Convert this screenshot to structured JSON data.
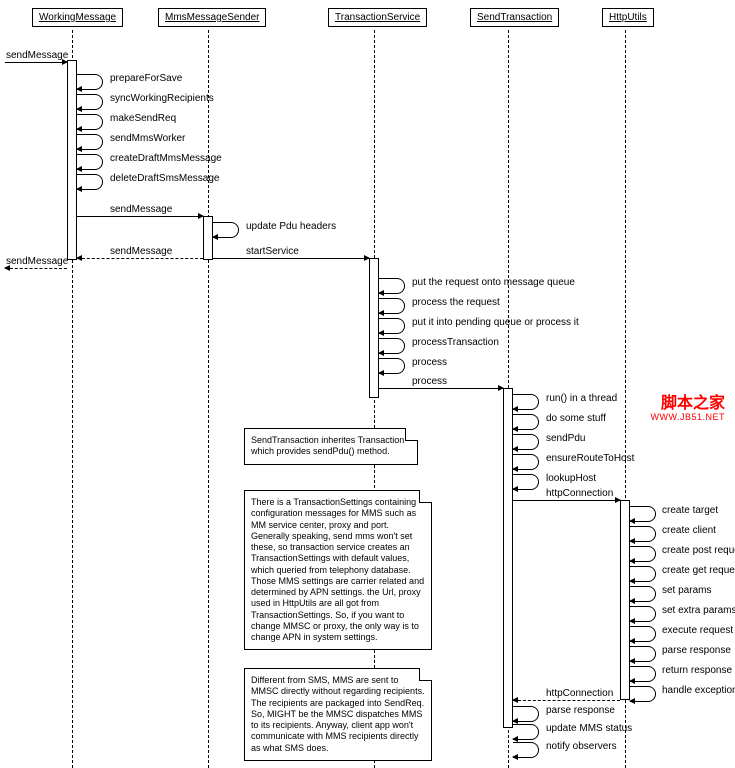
{
  "lifelines": {
    "l1": "WorkingMessage",
    "l2": "MmsMessageSender",
    "l3": "TransactionService",
    "l4": "SendTransaction",
    "l5": "HttpUtils"
  },
  "messages": {
    "sendMessage_in": "sendMessage",
    "prepareForSave": "prepareForSave",
    "syncWorkingRecipients": "syncWorkingRecipients",
    "makeSendReq": "makeSendReq",
    "sendMmsWorker": "sendMmsWorker",
    "createDraftMmsMessage": "createDraftMmsMessage",
    "deleteDraftSmsMessage": "deleteDraftSmsMessage",
    "sendMessage_1": "sendMessage",
    "updatePduHeaders": "update Pdu headers",
    "startService": "startService",
    "sendMessage_ret_mid": "sendMessage",
    "sendMessage_ret_out": "sendMessage",
    "putRequestQueue": "put the request onto message queue",
    "processRequest": "process the request",
    "pendingOrProcess": "put it into pending queue or process it",
    "processTransaction": "processTransaction",
    "process_1": "process",
    "process_2": "process",
    "runThread": "run() in a thread",
    "doSomeStuff": "do some stuff",
    "sendPdu": "sendPdu",
    "ensureRouteToHost": "ensureRouteToHost",
    "lookupHost": "lookupHost",
    "httpConnection_1": "httpConnection",
    "createTarget": "create target",
    "createClient": "create client",
    "createPostRequest": "create post request",
    "createGetRequest": "create get request",
    "setParams": "set params",
    "setExtraParams": "set extra params",
    "executeRequest": "execute request",
    "parseResponse_1": "parse response",
    "returnResponse": "return response",
    "handleExceptions": "handle exceptions",
    "httpConnection_ret": "httpConnection",
    "parseResponse_2": "parse response",
    "updateMmsStatus": "update MMS status",
    "notifyObservers": "notify observers"
  },
  "notes": {
    "n1": "SendTransaction inherites Transaction which provides sendPdu() method.",
    "n2": "There is a TransactionSettings containing configuration messages for MMS such as MM service center, proxy and port. Generally speaking, send mms won't set these, so transaction service creates an TransactionSettings with default values, which queried from telephony database. Those MMS settings are carrier related and determined by APN settings. the Url, proxy used in HttpUtils are all got from TransactionSettings. So, if you want to change MMSC or proxy, the only way is to change APN in system settings.",
    "n3": "Different from SMS, MMS are sent to MMSC directly without regarding recipients. The recipients are packaged into SendReq. So, MIGHT be the MMSC dispatches MMS to its recipients. Anyway, client app won't communicate with MMS recipients directly as what SMS does."
  },
  "watermark": {
    "cn": "脚本之家",
    "url": "WWW.JB51.NET"
  }
}
